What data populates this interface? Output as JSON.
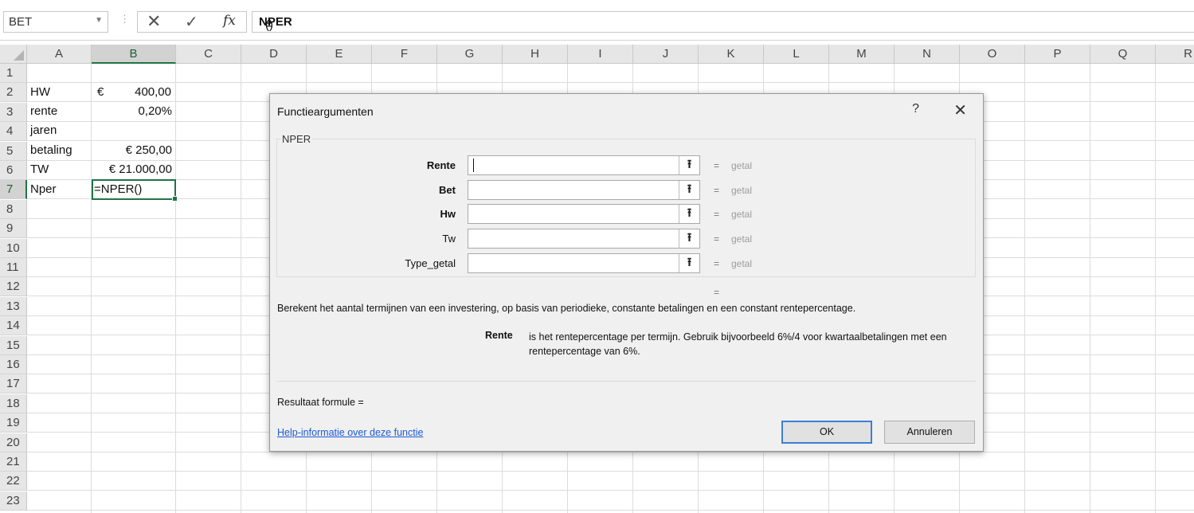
{
  "formula_bar": {
    "name_box": "BET",
    "cancel_icon": "✕",
    "enter_icon": "✓",
    "fx_label": "fx",
    "formula_prefix": "=",
    "formula_func": "NPER",
    "formula_suffix": "()"
  },
  "grid": {
    "columns": [
      "A",
      "B",
      "C",
      "D",
      "E",
      "F",
      "G",
      "H",
      "I",
      "J",
      "K",
      "L",
      "M",
      "N",
      "O",
      "P",
      "Q",
      "R"
    ],
    "rows": [
      "1",
      "2",
      "3",
      "4",
      "5",
      "6",
      "7",
      "8",
      "9",
      "10",
      "11",
      "12",
      "13",
      "14",
      "15",
      "16",
      "17",
      "18",
      "19",
      "20",
      "21",
      "22",
      "23"
    ],
    "selected_column": "B",
    "selected_row": "7",
    "cells": {
      "A2": "HW",
      "B2_currency": "€",
      "B2_value": "400,00",
      "A3": "rente",
      "B3": "0,20%",
      "A4": "jaren",
      "A5": "betaling",
      "B5": "€ 250,00",
      "A6": "TW",
      "B6": "€ 21.000,00",
      "A7": "Nper",
      "B7": "=NPER()"
    }
  },
  "dialog": {
    "title": "Functieargumenten",
    "help_icon": "?",
    "close_icon": "✕",
    "function_name": "NPER",
    "arguments": [
      {
        "label": "Rente",
        "value": "",
        "result": "getal",
        "equals": "="
      },
      {
        "label": "Bet",
        "value": "",
        "result": "getal",
        "equals": "="
      },
      {
        "label": "Hw",
        "value": "",
        "result": "getal",
        "equals": "="
      },
      {
        "label": "Tw",
        "value": "",
        "result": "getal",
        "equals": "="
      },
      {
        "label": "Type_getal",
        "value": "",
        "result": "getal",
        "equals": "="
      }
    ],
    "ref_button_icon": "⭱",
    "overall_equals": "=",
    "description": "Berekent het aantal termijnen van een investering, op basis van periodieke, constante betalingen en een constant rentepercentage.",
    "arg_help_name": "Rente",
    "arg_help_text": "is het rentepercentage per termijn. Gebruik bijvoorbeeld 6%/4 voor kwartaalbetalingen met een rentepercentage van 6%.",
    "result_label": "Resultaat formule =",
    "help_link": "Help-informatie over deze functie",
    "ok_label": "OK",
    "cancel_label": "Annuleren"
  }
}
